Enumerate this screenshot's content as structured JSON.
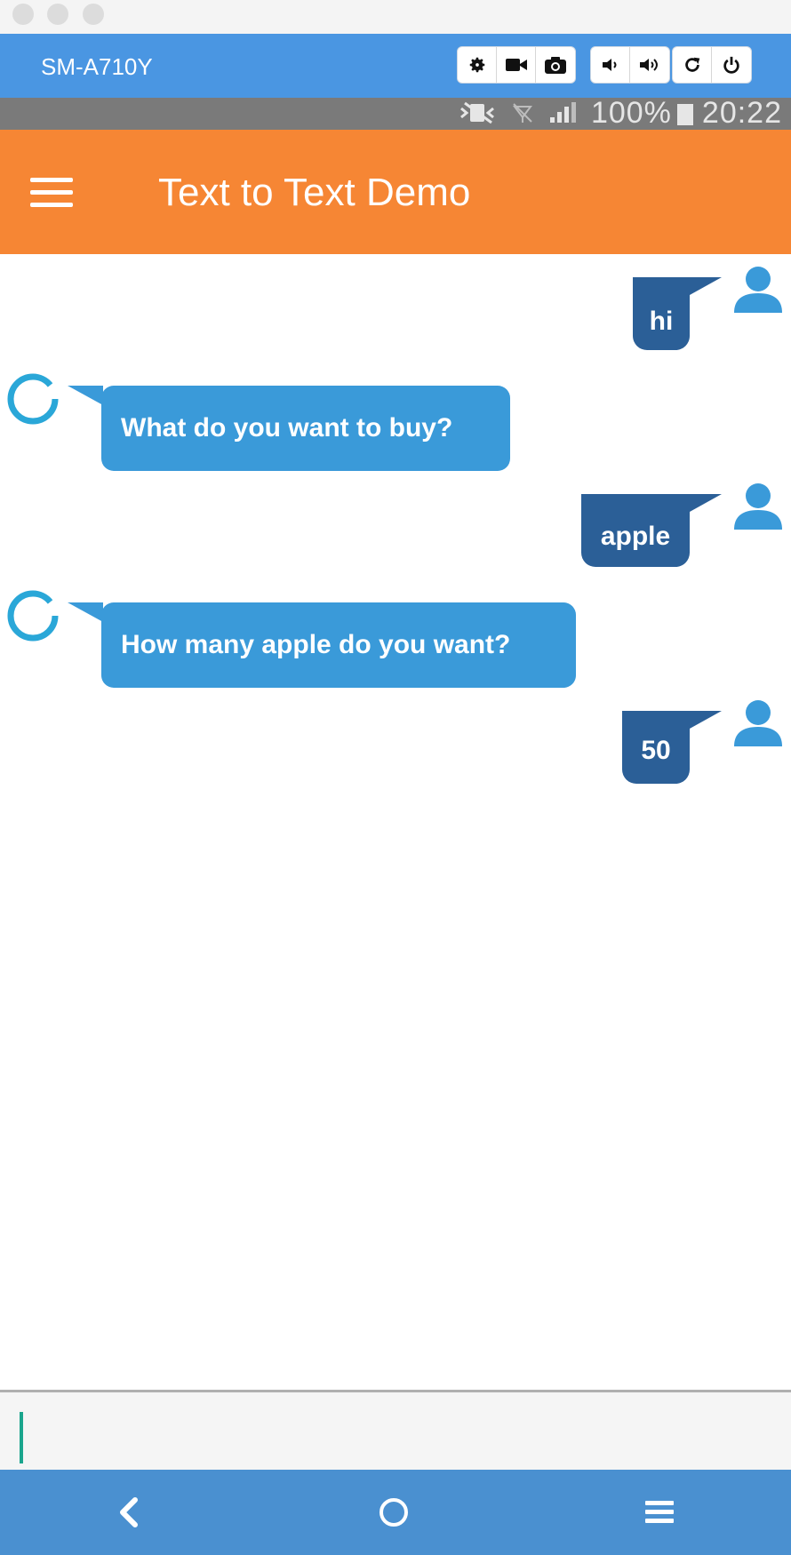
{
  "window": {
    "device_name": "SM-A710Y"
  },
  "device_toolbar": {
    "groups": [
      [
        "settings-icon",
        "video-camera-icon",
        "camera-icon"
      ],
      [
        "volume-down-icon",
        "volume-up-icon"
      ],
      [
        "rotate-icon",
        "power-icon"
      ]
    ]
  },
  "status_bar": {
    "battery": "100%",
    "time": "20:22"
  },
  "app_bar": {
    "title": "Text to Text Demo"
  },
  "messages": [
    {
      "sender": "user",
      "text": "hi"
    },
    {
      "sender": "bot",
      "text": "What do you want to buy?"
    },
    {
      "sender": "user",
      "text": "apple"
    },
    {
      "sender": "bot",
      "text": "How many apple do you want?"
    },
    {
      "sender": "user",
      "text": "50"
    }
  ],
  "input": {
    "value": ""
  },
  "nav_bar": {
    "buttons": [
      "back-icon",
      "home-icon",
      "menu-icon"
    ]
  },
  "colors": {
    "app_bar": "#f68634",
    "device_bar": "#4a96e2",
    "user_bubble": "#2b5f97",
    "bot_bubble": "#3a9ad9",
    "nav_bar": "#4a90d0"
  }
}
